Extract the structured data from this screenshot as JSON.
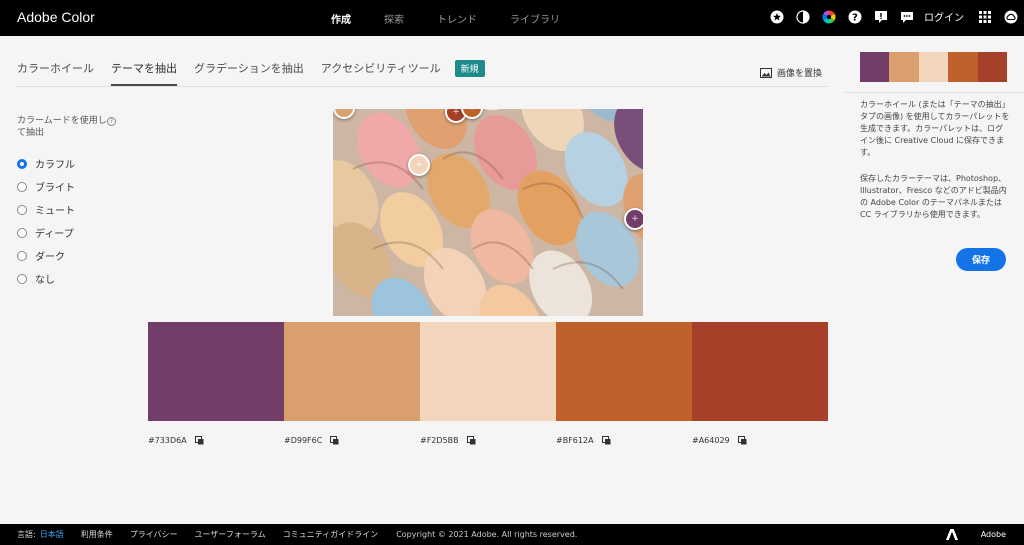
{
  "app": {
    "title": "Adobe Color"
  },
  "nav": {
    "items": [
      "作成",
      "探索",
      "トレンド",
      "ライブラリ"
    ]
  },
  "header": {
    "login": "ログイン"
  },
  "tabs": {
    "items": [
      "カラーホイール",
      "テーマを抽出",
      "グラデーションを抽出",
      "アクセシビリティツール"
    ],
    "badge": "新規",
    "replace": "画像を置換"
  },
  "mood": {
    "title": "カラームードを使用して抽出",
    "options": [
      "カラフル",
      "ブライト",
      "ミュート",
      "ディープ",
      "ダーク",
      "なし"
    ],
    "selected": "カラフル"
  },
  "theme": {
    "colors": [
      "#733D6A",
      "#D99F6C",
      "#F2D5BB",
      "#BF612A",
      "#A64029"
    ],
    "codes": [
      "#733D6A",
      "#D99F6C",
      "#F2D5BB",
      "#BF612A",
      "#A64029"
    ]
  },
  "right_panel": {
    "description1": "カラーホイール (または「テーマの抽出」タブの画像) を使用してカラーパレットを生成できます。カラーパレットは、ログイン後に Creative Cloud に保存できます。",
    "description2": "保存したカラーテーマは、Photoshop、Illustrator、Fresco などのアドビ製品内の Adobe Color のテーマパネルまたは CC ライブラリから使用できます。",
    "save": "保存"
  },
  "footer": {
    "lang_label": "言語:",
    "lang_value": "日本語",
    "links": [
      "利用条件",
      "プライバシー",
      "ユーザーフォーラム",
      "コミュニティガイドライン"
    ],
    "copyright": "Copyright © 2021 Adobe. All rights reserved.",
    "brand": "Adobe"
  },
  "icons": [
    "star-icon",
    "half-moon-icon",
    "color-wheel-icon",
    "help-icon",
    "alert-icon",
    "chat-icon",
    "apps-grid-icon",
    "creative-cloud-icon",
    "image-icon",
    "copy-icon",
    "info-icon",
    "adobe-logo-icon"
  ]
}
